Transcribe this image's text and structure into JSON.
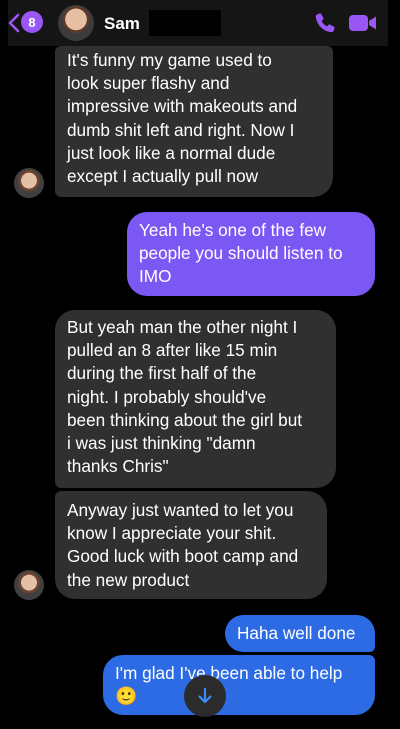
{
  "header": {
    "unread_count": "8",
    "contact_name": "Sam"
  },
  "messages": [
    {
      "direction": "incoming",
      "lines": [
        "It's funny my game used to",
        "look super flashy and",
        "impressive with makeouts and",
        "dumb shit left and right. Now I",
        "just look like a normal dude",
        "except I actually pull now"
      ]
    },
    {
      "direction": "outgoing",
      "lines": [
        "Yeah he's one of the few",
        "people you should listen to",
        "IMO"
      ]
    },
    {
      "direction": "incoming",
      "lines": [
        "But yeah man the other night I",
        "pulled an 8 after like 15 min",
        "during the first half of the",
        "night. I probably should've",
        "been thinking about the girl but",
        "i was just thinking \"damn",
        "thanks Chris\""
      ]
    },
    {
      "direction": "incoming",
      "lines": [
        "Anyway just wanted to let you",
        "know I appreciate your shit.",
        "Good luck with boot camp and",
        "the new product"
      ]
    },
    {
      "direction": "outgoing",
      "lines": [
        "Haha well done"
      ]
    },
    {
      "direction": "outgoing",
      "lines": [
        "I'm glad I've been able to help",
        "🙂"
      ]
    }
  ],
  "colors": {
    "accent": "#9b57f5",
    "incoming_bubble": "#303030",
    "outgoing_purple": "#7b57f3",
    "outgoing_blue": "#2d6be4"
  },
  "icons": [
    "back-chevron-icon",
    "phone-icon",
    "video-camera-icon",
    "scroll-down-arrow-icon"
  ]
}
